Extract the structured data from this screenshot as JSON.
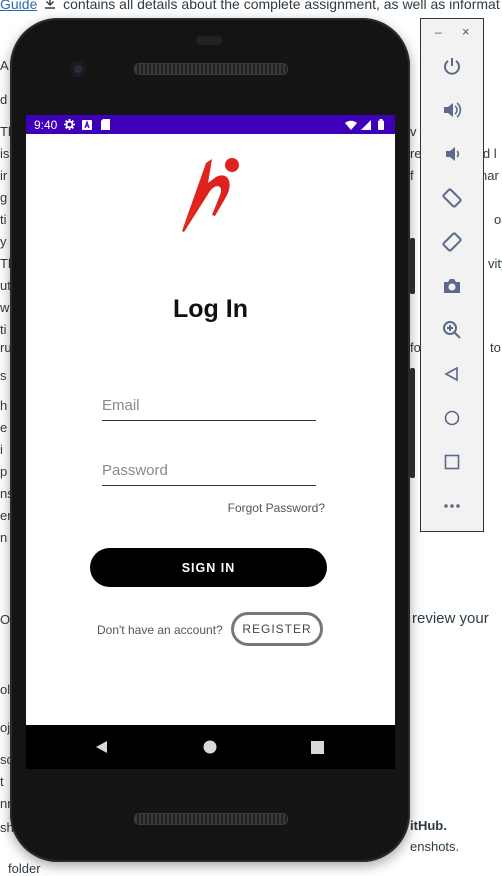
{
  "background": {
    "guide_link": "Guide",
    "line1": " contains all details about the complete assignment, as well as informat",
    "review_text": "review your",
    "github_text": "itHub.",
    "screenshots_text": "enshots.",
    "folder_text": "folder",
    "left_fragments": [
      "A",
      "d c",
      "Th",
      "is",
      "ir",
      "g",
      "ti",
      "y",
      "Th",
      "ut",
      "w",
      "ti",
      "ru",
      "s",
      "h",
      "e",
      "i",
      "p",
      "ns",
      "er",
      "n",
      "OU",
      "ol",
      "oj",
      "sc",
      "t",
      "nn",
      "sho"
    ],
    "right_fragments": [
      "v",
      "re",
      "ld l",
      "f",
      "har",
      "on s",
      "vity",
      "fo",
      "to"
    ]
  },
  "emulator": {
    "minimize_label": "–",
    "close_label": "×",
    "tools": [
      "power-icon",
      "volume-up-icon",
      "volume-down-icon",
      "rotate-left-icon",
      "rotate-right-icon",
      "camera-icon",
      "zoom-icon",
      "back-icon",
      "home-icon",
      "overview-icon",
      "more-icon"
    ]
  },
  "status_bar": {
    "time": "9:40"
  },
  "login": {
    "title": "Log In",
    "email_placeholder": "Email",
    "password_placeholder": "Password",
    "forgot_password": "Forgot Password?",
    "sign_in": "SIGN IN",
    "no_account": "Don't have an account?",
    "register": "REGISTER"
  },
  "colors": {
    "status_bar": "#3d00b8",
    "logo_red": "#e0221e",
    "button": "#000000"
  }
}
